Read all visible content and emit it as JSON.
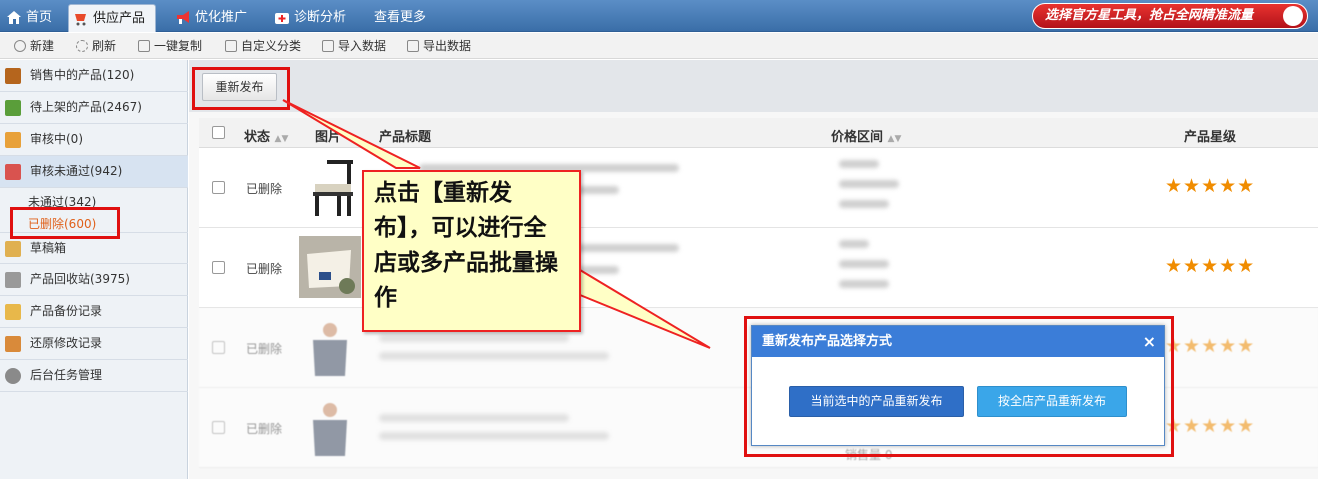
{
  "nav": {
    "tabs": [
      {
        "label": "首页",
        "icon": "home-icon"
      },
      {
        "label": "供应产品",
        "icon": "cart-icon"
      },
      {
        "label": "优化推广",
        "icon": "megaphone-icon"
      },
      {
        "label": "诊断分析",
        "icon": "medkit-icon"
      },
      {
        "label": "查看更多",
        "icon": ""
      }
    ],
    "promo": "选择官方星工具，抢占全网精准流量"
  },
  "toolbar": {
    "items": [
      "新建",
      "刷新",
      "一键复制",
      "自定义分类",
      "导入数据",
      "导出数据"
    ]
  },
  "sidebar": {
    "items": [
      {
        "label": "销售中的产品(120)",
        "icon": "store-icon"
      },
      {
        "label": "待上架的产品(2467)",
        "icon": "house-icon"
      },
      {
        "label": "审核中(0)",
        "icon": "audit-icon"
      },
      {
        "label": "审核未通过(942)",
        "icon": "reject-icon"
      },
      {
        "label": "草稿箱",
        "icon": "draft-icon"
      },
      {
        "label": "产品回收站(3975)",
        "icon": "trash-icon"
      },
      {
        "label": "产品备份记录",
        "icon": "folder-icon"
      },
      {
        "label": "还原修改记录",
        "icon": "restore-icon"
      },
      {
        "label": "后台任务管理",
        "icon": "gear-icon"
      }
    ],
    "sub": [
      "未通过(342)",
      "已删除(600)"
    ]
  },
  "main": {
    "republish_button": "重新发布",
    "headers": {
      "status": "状态",
      "image": "图片",
      "title": "产品标题",
      "price": "价格区间",
      "stars": "产品星级"
    },
    "rows": [
      {
        "status": "已删除",
        "stars": "★★★★★"
      },
      {
        "status": "已删除",
        "stars": "★★★★★"
      },
      {
        "status": "已删除",
        "stars": "★★★★★"
      },
      {
        "status": "已删除",
        "stars": "★★★★★"
      }
    ],
    "sold_text": "销售量 0"
  },
  "callout": "点击【重新发布】，可以进行全店或多产品批量操作",
  "dialog": {
    "title": "重新发布产品选择方式",
    "close": "×",
    "btn_selected": "当前选中的产品重新发布",
    "btn_all": "按全店产品重新发布"
  }
}
